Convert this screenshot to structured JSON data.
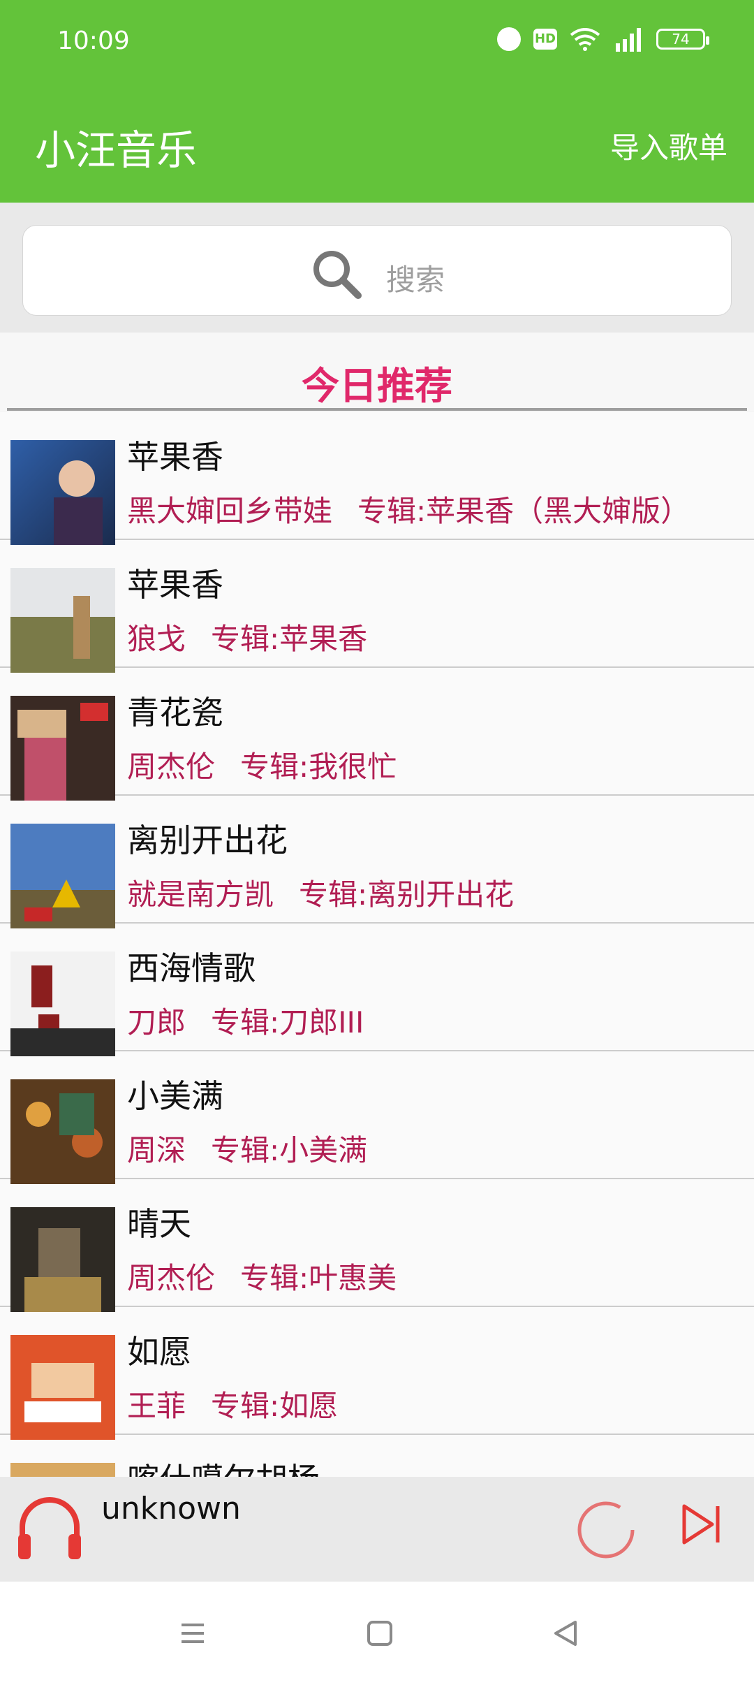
{
  "status": {
    "time": "10:09",
    "hd": "HD",
    "battery": "74"
  },
  "appbar": {
    "title": "小汪音乐",
    "import_label": "导入歌单"
  },
  "search": {
    "placeholder": "搜索"
  },
  "section": {
    "title": "今日推荐"
  },
  "songs": [
    {
      "title": "苹果香",
      "artist": "黑大婶回乡带娃",
      "album": "专辑:苹果香（黑大婶版）"
    },
    {
      "title": "苹果香",
      "artist": "狼戈",
      "album": "专辑:苹果香"
    },
    {
      "title": "青花瓷",
      "artist": "周杰伦",
      "album": "专辑:我很忙"
    },
    {
      "title": "离别开出花",
      "artist": "就是南方凯",
      "album": "专辑:离别开出花"
    },
    {
      "title": "西海情歌",
      "artist": "刀郎",
      "album": "专辑:刀郎III"
    },
    {
      "title": "小美满",
      "artist": "周深",
      "album": "专辑:小美满"
    },
    {
      "title": "晴天",
      "artist": "周杰伦",
      "album": "专辑:叶惠美"
    },
    {
      "title": "如愿",
      "artist": "王菲",
      "album": "专辑:如愿"
    },
    {
      "title": "喀什噶尔胡杨",
      "artist": "",
      "album": ""
    }
  ],
  "player": {
    "title": "unknown"
  },
  "colors": {
    "accent": "#63c33a",
    "section": "#e0286a",
    "meta": "#b11e53",
    "player_icon": "#e53935"
  }
}
